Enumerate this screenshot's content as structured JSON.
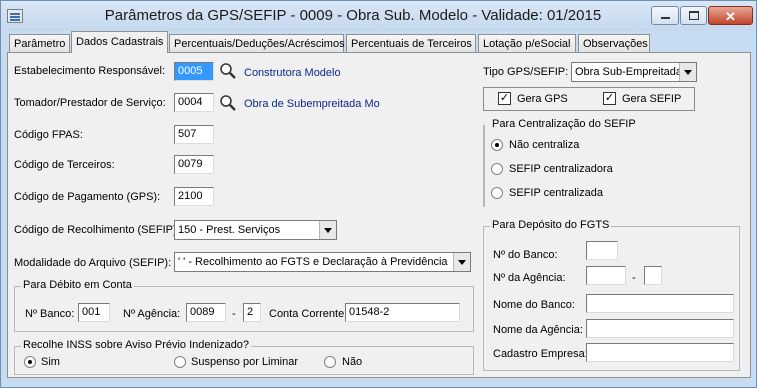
{
  "window": {
    "title": "Parâmetros da GPS/SEFIP - 0009 - Obra Sub. Modelo - Validade: 01/2015",
    "minimize": "minimize-icon",
    "maximize": "maximize-icon",
    "close": "close-icon"
  },
  "tabs": [
    "Parâmetro",
    "Dados Cadastrais",
    "Percentuais/Deduções/Acréscimos",
    "Percentuais de Terceiros",
    "Lotação p/eSocial",
    "Observações"
  ],
  "form": {
    "estab_label": "Estabelecimento Responsável:",
    "estab_value": "0005",
    "estab_name": "Construtora Modelo",
    "tomador_label": "Tomador/Prestador de Serviço:",
    "tomador_value": "0004",
    "tomador_name": "Obra de Subempreitada Mo",
    "fpas_label": "Código FPAS:",
    "fpas_value": "507",
    "terceiros_label": "Código de Terceiros:",
    "terceiros_value": "0079",
    "pagamento_label": "Código de Pagamento (GPS):",
    "pagamento_value": "2100",
    "recolhimento_label": "Código de Recolhimento (SEFIP):",
    "recolhimento_value": "150 - Prest. Serviços",
    "modalidade_label": "Modalidade do Arquivo (SEFIP):",
    "modalidade_value": "' ' - Recolhimento ao FGTS e Declaração à Previdência"
  },
  "debito": {
    "title": "Para Débito em Conta",
    "banco_label": "Nº Banco:",
    "banco_value": "001",
    "agencia_label": "Nº Agência:",
    "agencia_value": "0089",
    "dash": "-",
    "agencia_dv": "2",
    "conta_label": "Conta Corrente:",
    "conta_value": "01548-2"
  },
  "inss": {
    "title": "Recolhe INSS sobre Aviso Prévio Indenizado?",
    "options": [
      "Sim",
      "Suspenso por Liminar",
      "Não"
    ],
    "selected": "Sim"
  },
  "tipo": {
    "label": "Tipo GPS/SEFIP:",
    "value": "Obra Sub-Empreitada",
    "gera_gps": "Gera GPS",
    "gera_sefip": "Gera SEFIP",
    "check_mark": "✓"
  },
  "centralizacao": {
    "title": "Para Centralização do SEFIP",
    "options": [
      "Não centraliza",
      "SEFIP centralizadora",
      "SEFIP centralizada"
    ],
    "selected": "Não centraliza"
  },
  "fgts": {
    "title": "Para Depósito do FGTS",
    "banco_label": "Nº do Banco:",
    "agencia_label": "Nº da Agência:",
    "dash": "-",
    "nome_banco_label": "Nome do Banco:",
    "nome_agencia_label": "Nome da Agência:",
    "cadastro_label": "Cadastro Empresa:"
  }
}
